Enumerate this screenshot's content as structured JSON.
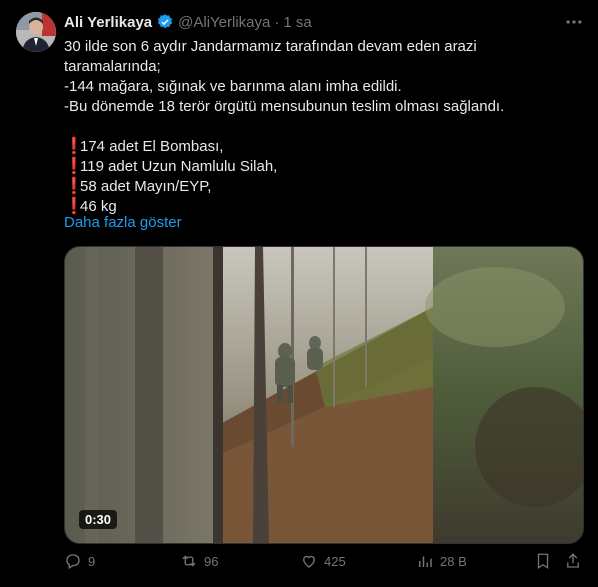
{
  "author": {
    "name": "Ali Yerlikaya",
    "handle": "@AliYerlikaya",
    "separator": "·",
    "time": "1 sa"
  },
  "tweet": {
    "lines": [
      "30 ilde son 6 aydır Jandarmamız tarafından devam eden arazi",
      "taramalarında;",
      "-144 mağara, sığınak ve barınma alanı imha edildi.",
      "-Bu dönemde 18 terör örgütü mensubunun teslim olması sağlandı."
    ],
    "list_marker": "❗",
    "list": [
      "174 adet El Bombası,",
      "119 adet Uzun Namlulu Silah,",
      "58 adet Mayın/EYP,",
      "46 kg"
    ],
    "show_more": "Daha fazla göster"
  },
  "media": {
    "duration": "0:30"
  },
  "actions": {
    "replies": "9",
    "retweets": "96",
    "likes": "425",
    "views": "28 B"
  },
  "colors": {
    "accent": "#1d9bf0",
    "muted": "#71767b",
    "text": "#e7e9ea",
    "marker": "#e0245e"
  }
}
